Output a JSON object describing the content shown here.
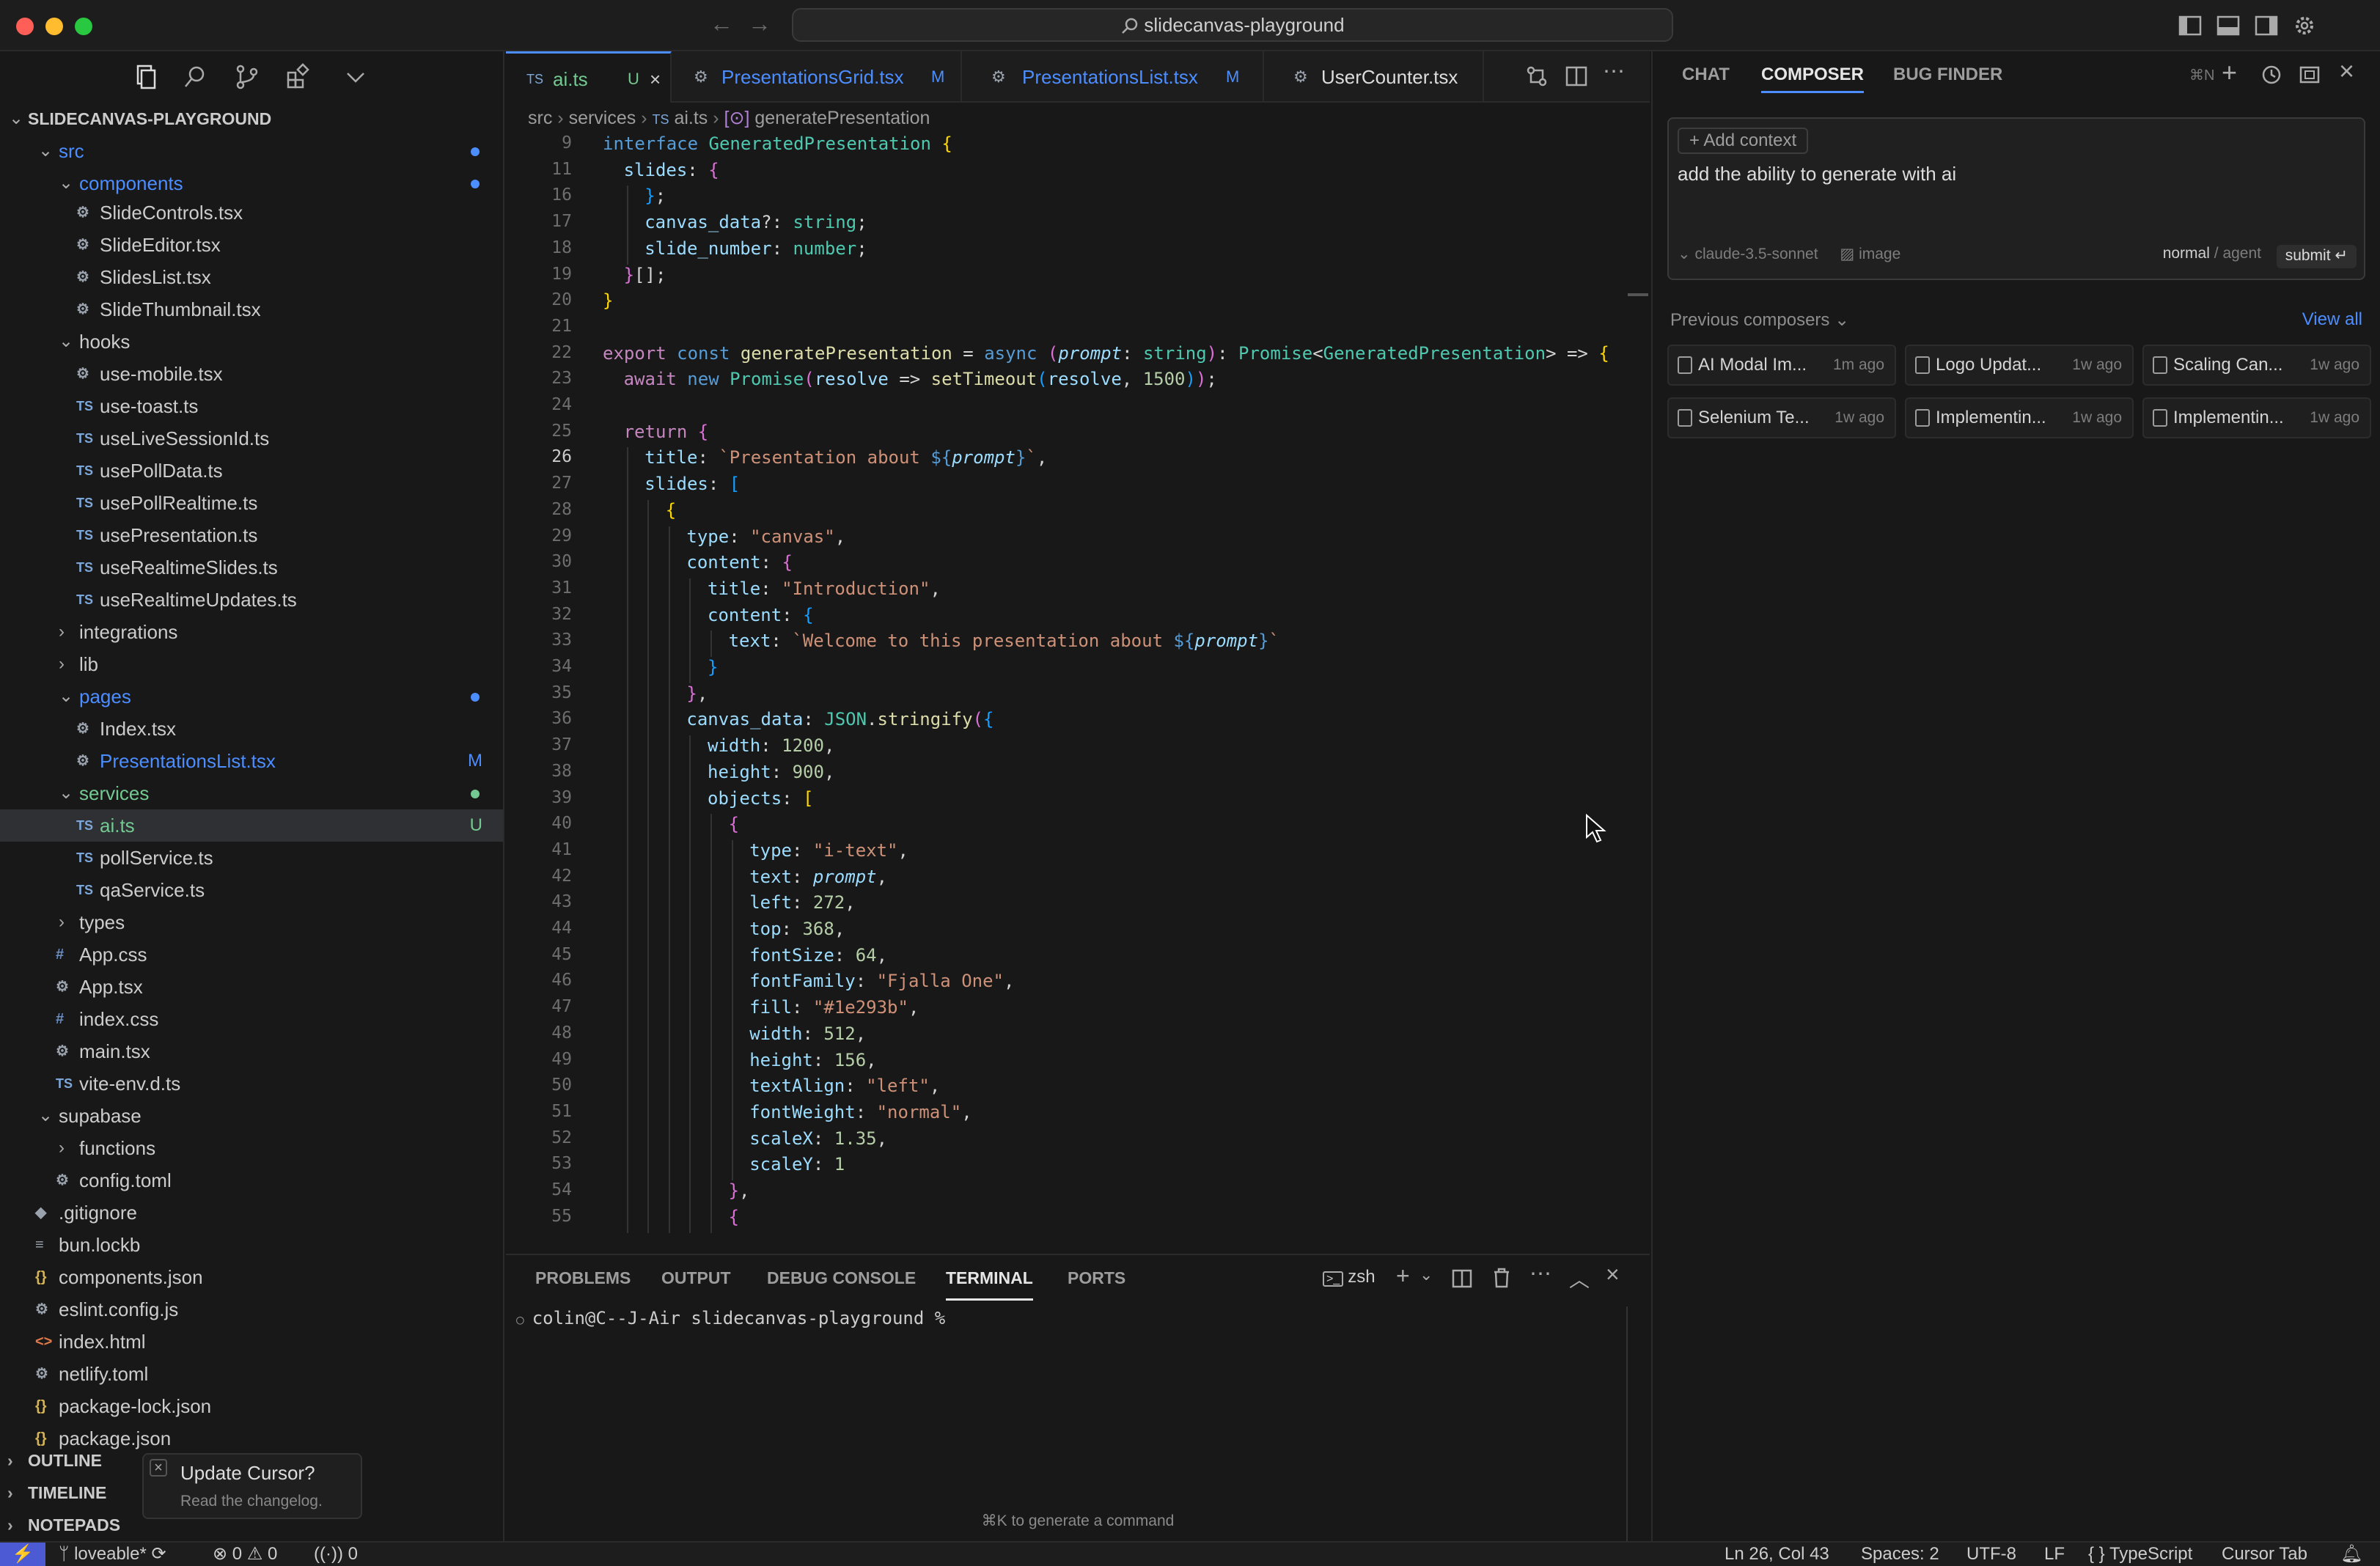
{
  "window": {
    "title": "slidecanvas-playground"
  },
  "explorer": {
    "root": "SLIDECANVAS-PLAYGROUND",
    "items": [
      {
        "label": "src",
        "indent": 1,
        "chev": "v",
        "icon": "",
        "color": "#4c8dff",
        "dot": "#4c8dff"
      },
      {
        "label": "components",
        "indent": 2,
        "chev": "v",
        "icon": "",
        "color": "#4c8dff",
        "dot": "#4c8dff"
      },
      {
        "label": "SlideControls.tsx",
        "indent": 3,
        "icon": "gear",
        "color": "#cccccc"
      },
      {
        "label": "SlideEditor.tsx",
        "indent": 3,
        "icon": "gear",
        "color": "#cccccc"
      },
      {
        "label": "SlidesList.tsx",
        "indent": 3,
        "icon": "gear",
        "color": "#cccccc"
      },
      {
        "label": "SlideThumbnail.tsx",
        "indent": 3,
        "icon": "gear",
        "color": "#cccccc"
      },
      {
        "label": "hooks",
        "indent": 2,
        "chev": "v",
        "icon": "",
        "color": "#cccccc"
      },
      {
        "label": "use-mobile.tsx",
        "indent": 3,
        "icon": "gear",
        "color": "#cccccc"
      },
      {
        "label": "use-toast.ts",
        "indent": 3,
        "icon": "ts",
        "color": "#cccccc"
      },
      {
        "label": "useLiveSessionId.ts",
        "indent": 3,
        "icon": "ts",
        "color": "#cccccc"
      },
      {
        "label": "usePollData.ts",
        "indent": 3,
        "icon": "ts",
        "color": "#cccccc"
      },
      {
        "label": "usePollRealtime.ts",
        "indent": 3,
        "icon": "ts",
        "color": "#cccccc"
      },
      {
        "label": "usePresentation.ts",
        "indent": 3,
        "icon": "ts",
        "color": "#cccccc"
      },
      {
        "label": "useRealtimeSlides.ts",
        "indent": 3,
        "icon": "ts",
        "color": "#cccccc"
      },
      {
        "label": "useRealtimeUpdates.ts",
        "indent": 3,
        "icon": "ts",
        "color": "#cccccc"
      },
      {
        "label": "integrations",
        "indent": 2,
        "chev": ">",
        "icon": "",
        "color": "#cccccc"
      },
      {
        "label": "lib",
        "indent": 2,
        "chev": ">",
        "icon": "",
        "color": "#cccccc"
      },
      {
        "label": "pages",
        "indent": 2,
        "chev": "v",
        "icon": "",
        "color": "#4c8dff",
        "dot": "#4c8dff"
      },
      {
        "label": "Index.tsx",
        "indent": 3,
        "icon": "gear",
        "color": "#cccccc"
      },
      {
        "label": "PresentationsList.tsx",
        "indent": 3,
        "icon": "gear",
        "color": "#4c8dff",
        "badge": "M",
        "badgeColor": "#4c8dff"
      },
      {
        "label": "services",
        "indent": 2,
        "chev": "v",
        "icon": "",
        "color": "#73c991",
        "dot": "#73c991"
      },
      {
        "label": "ai.ts",
        "indent": 3,
        "icon": "ts",
        "color": "#73c991",
        "badge": "U",
        "badgeColor": "#73c991",
        "selected": true
      },
      {
        "label": "pollService.ts",
        "indent": 3,
        "icon": "ts",
        "color": "#cccccc"
      },
      {
        "label": "qaService.ts",
        "indent": 3,
        "icon": "ts",
        "color": "#cccccc"
      },
      {
        "label": "types",
        "indent": 2,
        "chev": ">",
        "icon": "",
        "color": "#cccccc"
      },
      {
        "label": "App.css",
        "indent": 2,
        "icon": "hash",
        "color": "#cccccc"
      },
      {
        "label": "App.tsx",
        "indent": 2,
        "icon": "gear",
        "color": "#cccccc"
      },
      {
        "label": "index.css",
        "indent": 2,
        "icon": "hash",
        "color": "#cccccc"
      },
      {
        "label": "main.tsx",
        "indent": 2,
        "icon": "gear",
        "color": "#cccccc"
      },
      {
        "label": "vite-env.d.ts",
        "indent": 2,
        "icon": "ts",
        "color": "#cccccc"
      },
      {
        "label": "supabase",
        "indent": 1,
        "chev": "v",
        "icon": "",
        "color": "#cccccc"
      },
      {
        "label": "functions",
        "indent": 2,
        "chev": ">",
        "icon": "",
        "color": "#cccccc"
      },
      {
        "label": "config.toml",
        "indent": 2,
        "icon": "gear",
        "color": "#cccccc"
      },
      {
        "label": ".gitignore",
        "indent": 1,
        "icon": "git",
        "color": "#cccccc"
      },
      {
        "label": "bun.lockb",
        "indent": 1,
        "icon": "lines",
        "color": "#cccccc"
      },
      {
        "label": "components.json",
        "indent": 1,
        "icon": "brace",
        "color": "#cccccc"
      },
      {
        "label": "eslint.config.js",
        "indent": 1,
        "icon": "gear",
        "color": "#cccccc"
      },
      {
        "label": "index.html",
        "indent": 1,
        "icon": "html",
        "color": "#cccccc"
      },
      {
        "label": "netlify.toml",
        "indent": 1,
        "icon": "gear",
        "color": "#cccccc"
      },
      {
        "label": "package-lock.json",
        "indent": 1,
        "icon": "brace",
        "color": "#cccccc"
      },
      {
        "label": "package.json",
        "indent": 1,
        "icon": "brace",
        "color": "#cccccc"
      }
    ],
    "sections": [
      "OUTLINE",
      "TIMELINE",
      "NOTEPADS"
    ]
  },
  "toast": {
    "title": "Update Cursor?",
    "subtitle": "Read the changelog."
  },
  "editor": {
    "tabs": [
      {
        "label": "ai.ts",
        "icon": "TS",
        "badge": "U",
        "active": true,
        "color": "#73c991"
      },
      {
        "label": "PresentationsGrid.tsx",
        "icon": "gear",
        "badge": "M",
        "color": "#4c8dff"
      },
      {
        "label": "PresentationsList.tsx",
        "icon": "gear",
        "badge": "M",
        "color": "#4c8dff"
      },
      {
        "label": "UserCounter.tsx",
        "icon": "gear",
        "badge": "",
        "color": "#cccccc"
      }
    ],
    "breadcrumb": [
      "src",
      "services",
      "ai.ts",
      "generatePresentation"
    ],
    "current_line": 26,
    "lines": [
      {
        "n": 9,
        "indent": 0,
        "html": "<span class='kb'>interface</span> <span class='t'>GeneratedPresentation</span> <span class='b1'>{</span>"
      },
      {
        "n": 11,
        "indent": 1,
        "html": "<span class='p'>slides</span>: <span class='b2'>{</span>"
      },
      {
        "n": 16,
        "indent": 2,
        "html": "<span class='b3'>}</span>;"
      },
      {
        "n": 17,
        "indent": 2,
        "html": "<span class='p'>canvas_data</span>?: <span class='t'>string</span>;"
      },
      {
        "n": 18,
        "indent": 2,
        "html": "<span class='p'>slide_number</span>: <span class='t'>number</span>;"
      },
      {
        "n": 19,
        "indent": 1,
        "html": "<span class='b2'>}</span>[];"
      },
      {
        "n": 20,
        "indent": 0,
        "html": "<span class='b1'>}</span>"
      },
      {
        "n": 21,
        "indent": 0,
        "html": ""
      },
      {
        "n": 22,
        "indent": 0,
        "html": "<span class='k'>export</span> <span class='kb'>const</span> <span class='f'>generatePresentation</span> = <span class='kb'>async</span> <span class='b2'>(</span><span class='p it'>prompt</span>: <span class='t'>string</span><span class='b2'>)</span>: <span class='t'>Promise</span>&lt;<span class='t'>GeneratedPresentation</span>&gt; =&gt; <span class='b1'>{</span>"
      },
      {
        "n": 23,
        "indent": 1,
        "html": "<span class='k'>await</span> <span class='kb'>new</span> <span class='t'>Promise</span><span class='b2'>(</span><span class='p'>resolve</span> =&gt; <span class='f'>setTimeout</span><span class='b3'>(</span><span class='p'>resolve</span>, <span class='n'>1500</span><span class='b3'>)</span><span class='b2'>)</span>;"
      },
      {
        "n": 24,
        "indent": 0,
        "html": ""
      },
      {
        "n": 25,
        "indent": 1,
        "html": "<span class='k'>return</span> <span class='b2'>{</span>"
      },
      {
        "n": 26,
        "indent": 2,
        "html": "<span class='p'>title</span>: <span class='s'>`Presentation about </span><span class='kb'>${</span><span class='p it'>prompt</span><span class='kb'>}</span><span class='s'>`</span>,"
      },
      {
        "n": 27,
        "indent": 2,
        "html": "<span class='p'>slides</span>: <span class='b3'>[</span>"
      },
      {
        "n": 28,
        "indent": 3,
        "html": "<span class='b1'>{</span>"
      },
      {
        "n": 29,
        "indent": 4,
        "html": "<span class='p'>type</span>: <span class='s'>\"canvas\"</span>,"
      },
      {
        "n": 30,
        "indent": 4,
        "html": "<span class='p'>content</span>: <span class='b2'>{</span>"
      },
      {
        "n": 31,
        "indent": 5,
        "html": "<span class='p'>title</span>: <span class='s'>\"Introduction\"</span>,"
      },
      {
        "n": 32,
        "indent": 5,
        "html": "<span class='p'>content</span>: <span class='b3'>{</span>"
      },
      {
        "n": 33,
        "indent": 6,
        "html": "<span class='p'>text</span>: <span class='s'>`Welcome to this presentation about </span><span class='kb'>${</span><span class='p it'>prompt</span><span class='kb'>}</span><span class='s'>`</span>"
      },
      {
        "n": 34,
        "indent": 5,
        "html": "<span class='b3'>}</span>"
      },
      {
        "n": 35,
        "indent": 4,
        "html": "<span class='b2'>}</span>,"
      },
      {
        "n": 36,
        "indent": 4,
        "html": "<span class='p'>canvas_data</span>: <span class='t'>JSON</span>.<span class='f'>stringify</span><span class='b2'>(</span><span class='b3'>{</span>"
      },
      {
        "n": 37,
        "indent": 5,
        "html": "<span class='p'>width</span>: <span class='n'>1200</span>,"
      },
      {
        "n": 38,
        "indent": 5,
        "html": "<span class='p'>height</span>: <span class='n'>900</span>,"
      },
      {
        "n": 39,
        "indent": 5,
        "html": "<span class='p'>objects</span>: <span class='b1'>[</span>"
      },
      {
        "n": 40,
        "indent": 6,
        "html": "<span class='b2'>{</span>"
      },
      {
        "n": 41,
        "indent": 7,
        "html": "<span class='p'>type</span>: <span class='s'>\"i-text\"</span>,"
      },
      {
        "n": 42,
        "indent": 7,
        "html": "<span class='p'>text</span>: <span class='p it'>prompt</span>,"
      },
      {
        "n": 43,
        "indent": 7,
        "html": "<span class='p'>left</span>: <span class='n'>272</span>,"
      },
      {
        "n": 44,
        "indent": 7,
        "html": "<span class='p'>top</span>: <span class='n'>368</span>,"
      },
      {
        "n": 45,
        "indent": 7,
        "html": "<span class='p'>fontSize</span>: <span class='n'>64</span>,"
      },
      {
        "n": 46,
        "indent": 7,
        "html": "<span class='p'>fontFamily</span>: <span class='s'>\"Fjalla One\"</span>,"
      },
      {
        "n": 47,
        "indent": 7,
        "html": "<span class='p'>fill</span>: <span class='s'>\"#1e293b\"</span>,"
      },
      {
        "n": 48,
        "indent": 7,
        "html": "<span class='p'>width</span>: <span class='n'>512</span>,"
      },
      {
        "n": 49,
        "indent": 7,
        "html": "<span class='p'>height</span>: <span class='n'>156</span>,"
      },
      {
        "n": 50,
        "indent": 7,
        "html": "<span class='p'>textAlign</span>: <span class='s'>\"left\"</span>,"
      },
      {
        "n": 51,
        "indent": 7,
        "html": "<span class='p'>fontWeight</span>: <span class='s'>\"normal\"</span>,"
      },
      {
        "n": 52,
        "indent": 7,
        "html": "<span class='p'>scaleX</span>: <span class='n'>1.35</span>,"
      },
      {
        "n": 53,
        "indent": 7,
        "html": "<span class='p'>scaleY</span>: <span class='n'>1</span>"
      },
      {
        "n": 54,
        "indent": 6,
        "html": "<span class='b2'>}</span>,"
      },
      {
        "n": 55,
        "indent": 6,
        "html": "<span class='b2'>{</span>"
      }
    ]
  },
  "panel": {
    "tabs": [
      "PROBLEMS",
      "OUTPUT",
      "DEBUG CONSOLE",
      "TERMINAL",
      "PORTS"
    ],
    "active_tab": "TERMINAL",
    "shell": "zsh",
    "prompt": "colin@C--J-Air slidecanvas-playground %",
    "hint": "⌘K to generate a command"
  },
  "composer": {
    "tabs": [
      "CHAT",
      "COMPOSER",
      "BUG FINDER"
    ],
    "active_tab": "COMPOSER",
    "shortcut": "⌘N",
    "add_context": "Add context",
    "input_text": "add the ability to generate with ai",
    "model": "claude-3.5-sonnet",
    "image_label": "image",
    "mode_normal": "normal",
    "mode_sep": "/",
    "mode_agent": "agent",
    "submit": "submit ↵",
    "previous_label": "Previous composers",
    "view_all": "View all",
    "previous": [
      {
        "title": "AI Modal Im...",
        "age": "1m ago"
      },
      {
        "title": "Logo Updat...",
        "age": "1w ago"
      },
      {
        "title": "Scaling Can...",
        "age": "1w ago"
      },
      {
        "title": "Selenium Te...",
        "age": "1w ago"
      },
      {
        "title": "Implementin...",
        "age": "1w ago"
      },
      {
        "title": "Implementin...",
        "age": "1w ago"
      }
    ]
  },
  "status": {
    "branch": "loveable*",
    "errors": "0",
    "warnings": "0",
    "ports": "0",
    "cursor_pos": "Ln 26, Col 43",
    "spaces": "Spaces: 2",
    "encoding": "UTF-8",
    "eol": "LF",
    "language": "TypeScript",
    "cursor_tab": "Cursor Tab"
  }
}
